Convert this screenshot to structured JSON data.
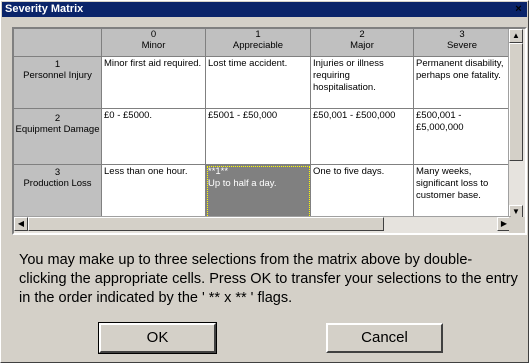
{
  "window": {
    "title": "Severity Matrix",
    "close_glyph": "×"
  },
  "matrix": {
    "columns": [
      {
        "number": "0",
        "label": "Minor"
      },
      {
        "number": "1",
        "label": "Appreciable"
      },
      {
        "number": "2",
        "label": "Major"
      },
      {
        "number": "3",
        "label": "Severe"
      }
    ],
    "rows": [
      {
        "number": "1",
        "label": "Personnel Injury",
        "cells": [
          "Minor first aid required.",
          "Lost time accident.",
          "Injuries or illness requiring hospitalisation.",
          "Permanent disability, perhaps one fatality."
        ]
      },
      {
        "number": "2",
        "label": "Equipment Damage",
        "cells": [
          "£0 - £5000.",
          "£5001 - £50,000",
          "£50,001 - £500,000",
          "£500,001 - £5,000,000"
        ]
      },
      {
        "number": "3",
        "label": "Production Loss",
        "cells": [
          "Less than one hour.",
          "Up to half a day.",
          "One to five days.",
          "Many weeks, significant loss to customer base."
        ]
      }
    ],
    "selected_flag": "**1**"
  },
  "instructions": "You may make up to three selections from the matrix above by double-clicking the appropriate cells.  Press OK to transfer your selections to the entry in the order indicated  by the ' ** x ** ' flags.",
  "buttons": {
    "ok": "OK",
    "cancel": "Cancel"
  }
}
